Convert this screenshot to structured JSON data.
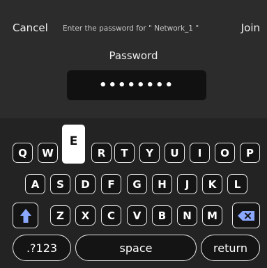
{
  "header": {
    "cancel_label": "Cancel",
    "join_label": "Join",
    "prompt": "Enter the password for \" Network_1 \""
  },
  "password": {
    "label": "Password",
    "masked_value": "••••••••"
  },
  "keyboard": {
    "row1": [
      "Q",
      "W",
      "E",
      "R",
      "T",
      "Y",
      "U",
      "I",
      "O",
      "P"
    ],
    "row2": [
      "A",
      "S",
      "D",
      "F",
      "G",
      "H",
      "J",
      "K",
      "L"
    ],
    "row3": [
      "Z",
      "X",
      "C",
      "V",
      "B",
      "N",
      "M"
    ],
    "pressed_key": "E",
    "numbers_label": ".?123",
    "space_label": "space",
    "return_label": "return",
    "icons": {
      "shift": "shift-arrow-icon",
      "delete": "backspace-icon"
    },
    "colors": {
      "accent_icon": "#8aa8ff"
    }
  }
}
